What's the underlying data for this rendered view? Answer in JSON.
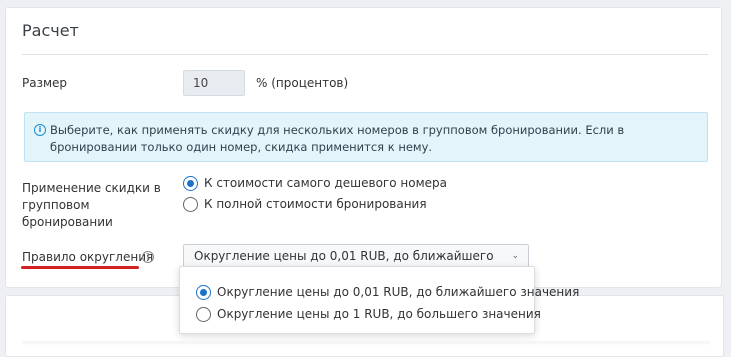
{
  "card": {
    "title": "Расчет"
  },
  "size": {
    "label": "Размер",
    "value": "10",
    "unit": "% (процентов)"
  },
  "info": {
    "icon": "info-icon",
    "text": "Выберите, как применять скидку для нескольких номеров в групповом бронировании. Если в бронировании только один номер, скидка применится к нему."
  },
  "discount_application": {
    "label": "Применение скидки в групповом бронировании",
    "options": [
      {
        "label": "К стоимости самого дешевого номера",
        "checked": true
      },
      {
        "label": "К полной стоимости бронирования",
        "checked": false
      }
    ]
  },
  "rounding": {
    "label": "Правило округления",
    "help_icon": "help-icon",
    "selected": "Округление цены до 0,01 RUB, до ближайшего значения",
    "options": [
      {
        "label": "Округление цены до 0,01 RUB, до ближайшего значения",
        "checked": true
      },
      {
        "label": "Округление цены до 1 RUB, до большего значения",
        "checked": false
      }
    ]
  },
  "colors": {
    "accent": "#1a73c9",
    "info_bg": "#e3f4fb",
    "highlight": "#d32020"
  }
}
